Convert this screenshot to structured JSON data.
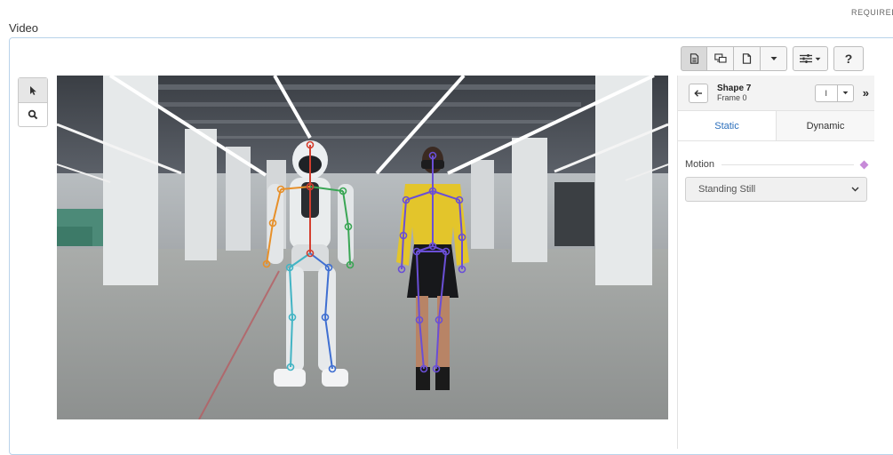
{
  "header": {
    "required_label": "REQUIRED",
    "section_title": "Video"
  },
  "tools": [
    {
      "name": "pointer",
      "icon": "cursor-arrow-icon",
      "active": true
    },
    {
      "name": "zoom",
      "icon": "magnifier-icon",
      "active": false
    }
  ],
  "toolbar": {
    "help_label": "?"
  },
  "panel": {
    "shape_title": "Shape 7",
    "frame_label": "Frame 0",
    "mini_value": "I",
    "next_label": "»",
    "tabs": [
      {
        "label": "Static",
        "active": true
      },
      {
        "label": "Dynamic",
        "active": false
      }
    ],
    "motion_label": "Motion",
    "motion_value": "Standing Still"
  },
  "colors": {
    "accent": "#2a6ebb",
    "frame_border": "#b9d3ea",
    "keyframe_diamond": "#c78ad8",
    "robot_skeleton_spine": "#d43f2f",
    "robot_skeleton_left_arm": "#e7902a",
    "robot_skeleton_right_arm": "#3aa655",
    "robot_skeleton_legs": "#42b4c4",
    "woman_skeleton": "#6a4fd6"
  }
}
